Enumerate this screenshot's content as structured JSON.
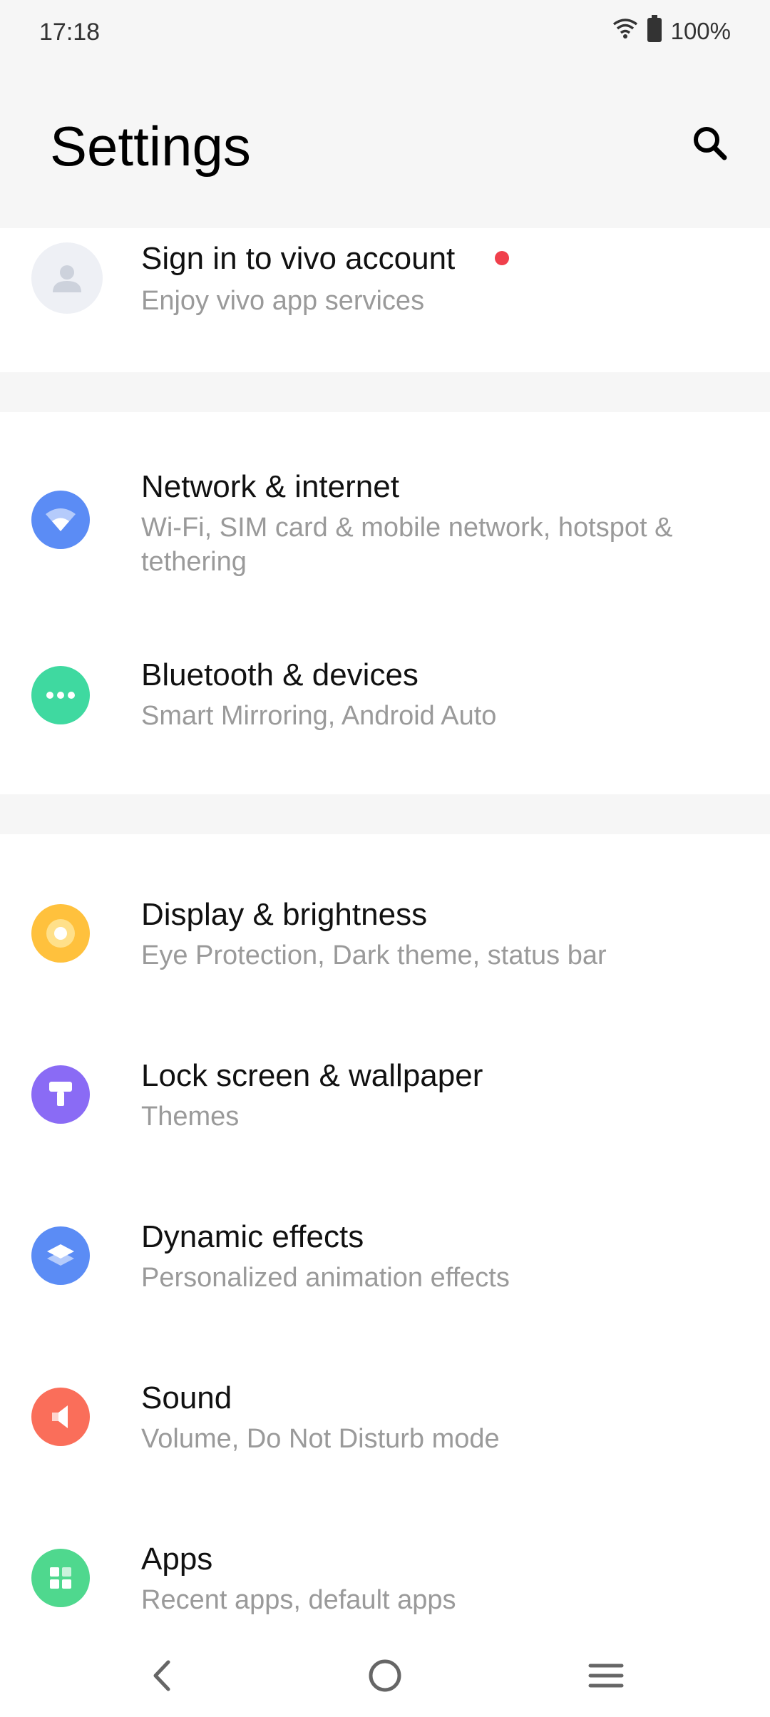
{
  "status": {
    "time": "17:18",
    "battery": "100%"
  },
  "header": {
    "title": "Settings"
  },
  "account": {
    "title": "Sign in to vivo account",
    "subtitle": "Enjoy vivo app services"
  },
  "items": [
    {
      "title": "Network & internet",
      "subtitle": "Wi-Fi, SIM card & mobile network, hotspot & tethering",
      "icon": "wifi-icon",
      "color": "#5b8cf5"
    },
    {
      "title": "Bluetooth & devices",
      "subtitle": "Smart Mirroring, Android Auto",
      "icon": "dots-icon",
      "color": "#3fd9a0"
    },
    {
      "title": "Display & brightness",
      "subtitle": "Eye Protection, Dark theme, status bar",
      "icon": "brightness-icon",
      "color": "#ffc13d"
    },
    {
      "title": "Lock screen & wallpaper",
      "subtitle": "Themes",
      "icon": "brush-icon",
      "color": "#8a6bf5"
    },
    {
      "title": "Dynamic effects",
      "subtitle": "Personalized animation effects",
      "icon": "layers-icon",
      "color": "#5b8cf5"
    },
    {
      "title": "Sound",
      "subtitle": "Volume, Do Not Disturb mode",
      "icon": "speaker-icon",
      "color": "#fa6e5a"
    },
    {
      "title": "Apps",
      "subtitle": "Recent apps, default apps",
      "icon": "apps-grid-icon",
      "color": "#4fd88e"
    }
  ]
}
